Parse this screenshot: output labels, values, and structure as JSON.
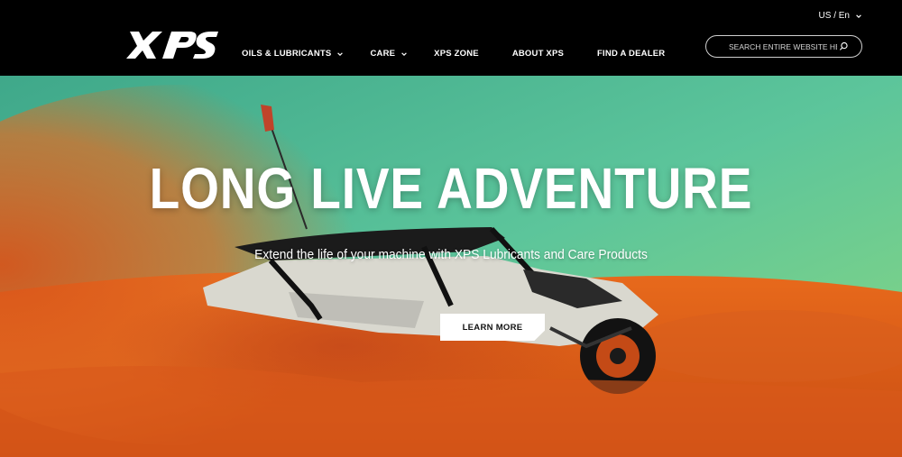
{
  "header": {
    "brand": "XPS",
    "locale": "US / En",
    "nav": [
      {
        "label": "OILS & LUBRICANTS",
        "has_dropdown": true
      },
      {
        "label": "CARE",
        "has_dropdown": true
      },
      {
        "label": "XPS ZONE",
        "has_dropdown": false
      },
      {
        "label": "ABOUT XPS",
        "has_dropdown": false
      },
      {
        "label": "FIND A DEALER",
        "has_dropdown": false
      }
    ],
    "search": {
      "placeholder": "SEARCH ENTIRE WEBSITE HERE",
      "icon": "search-icon"
    }
  },
  "hero": {
    "headline": "LONG LIVE ADVENTURE",
    "subheadline": "Extend the life of your machine with XPS Lubricants and Care Products",
    "cta_label": "LEARN MORE"
  },
  "colors": {
    "header_bg": "#000000",
    "sky": "#5fc79a",
    "sand": "#e0631c",
    "cta_bg": "#ffffff"
  }
}
